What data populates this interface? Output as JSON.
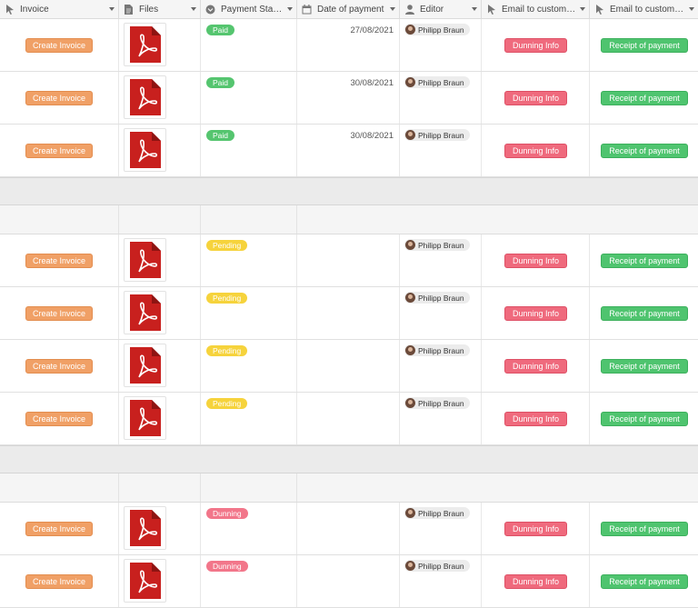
{
  "columns": [
    {
      "label": "Invoice",
      "icon": "cursor-icon"
    },
    {
      "label": "Files",
      "icon": "file-icon"
    },
    {
      "label": "Payment Status",
      "icon": "single-select-icon"
    },
    {
      "label": "Date of payment",
      "icon": "calendar-icon"
    },
    {
      "label": "Editor",
      "icon": "person-icon"
    },
    {
      "label": "Email to customer…",
      "icon": "cursor-icon"
    },
    {
      "label": "Email to customer…",
      "icon": "cursor-icon"
    }
  ],
  "buttons": {
    "create": "Create Invoice",
    "dunning": "Dunning Info",
    "receipt": "Receipt of payment"
  },
  "editor_name": "Philipp Braun",
  "rows": [
    {
      "status": "Paid",
      "date": "27/08/2021",
      "editor": "Philipp Braun"
    },
    {
      "status": "Paid",
      "date": "30/08/2021",
      "editor": "Philipp Braun"
    },
    {
      "status": "Paid",
      "date": "30/08/2021",
      "editor": "Philipp Braun"
    },
    {
      "status": "Pending",
      "date": "",
      "editor": "Philipp Braun"
    },
    {
      "status": "Pending",
      "date": "",
      "editor": "Philipp Braun"
    },
    {
      "status": "Pending",
      "date": "",
      "editor": "Philipp Braun"
    },
    {
      "status": "Pending",
      "date": "",
      "editor": "Philipp Braun"
    },
    {
      "status": "Dunning",
      "date": "",
      "editor": "Philipp Braun"
    },
    {
      "status": "Dunning",
      "date": "",
      "editor": "Philipp Braun"
    }
  ],
  "colors": {
    "create": "#f0a066",
    "dunning_button": "#ef6a7d",
    "receipt": "#4fc46f",
    "paid": "#55c56f",
    "pending": "#f6d33c",
    "dunning_badge": "#f2768a"
  }
}
